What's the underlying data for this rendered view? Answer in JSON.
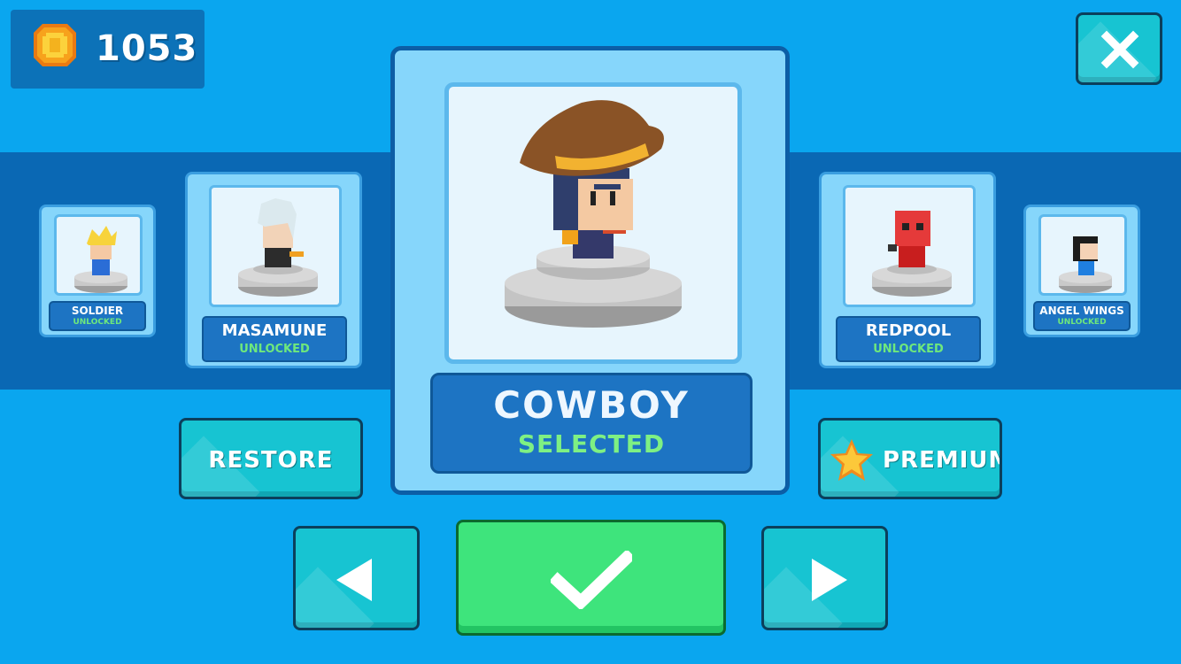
{
  "wallet": {
    "coins": "1053",
    "icon": "coin-icon"
  },
  "close_button": {
    "icon": "close-icon"
  },
  "characters": {
    "far_left": {
      "name": "SOLDIER",
      "status": "UNLOCKED"
    },
    "left": {
      "name": "MASAMUNE",
      "status": "UNLOCKED"
    },
    "selected": {
      "name": "COWBOY",
      "status": "SELECTED"
    },
    "right": {
      "name": "REDPOOL",
      "status": "UNLOCKED"
    },
    "far_right": {
      "name": "ANGEL WINGS",
      "status": "UNLOCKED"
    }
  },
  "buttons": {
    "restore": "RESTORE",
    "premium": "PREMIUM",
    "premium_icon": "star-icon",
    "prev_icon": "arrow-left-icon",
    "next_icon": "arrow-right-icon",
    "confirm_icon": "checkmark-icon"
  },
  "colors": {
    "background": "#0aa6ef",
    "band": "#0a68b4",
    "teal_button": "#17c4d2",
    "confirm_button": "#3ee47c",
    "status_green": "#6ee87c"
  }
}
